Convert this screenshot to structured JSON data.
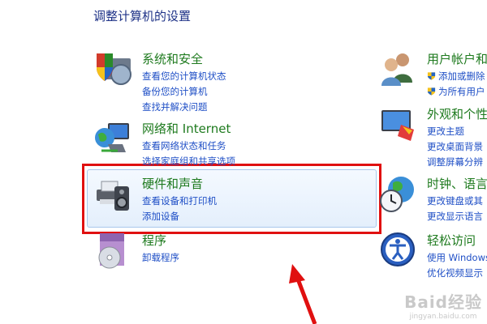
{
  "page_title": "调整计算机的设置",
  "left_column": [
    {
      "title": "系统和安全",
      "icon": "shield-computer-icon",
      "links": [
        "查看您的计算机状态",
        "备份您的计算机",
        "查找并解决问题"
      ]
    },
    {
      "title": "网络和 Internet",
      "icon": "globe-network-icon",
      "links": [
        "查看网络状态和任务",
        "选择家庭组和共享选项"
      ]
    },
    {
      "title": "硬件和声音",
      "icon": "printer-speaker-icon",
      "links": [
        "查看设备和打印机",
        "添加设备"
      ],
      "highlighted": true
    },
    {
      "title": "程序",
      "icon": "programs-disc-icon",
      "links": [
        "卸载程序"
      ]
    }
  ],
  "right_column": [
    {
      "title": "用户帐户和",
      "icon": "users-icon",
      "links": [
        "添加或删除",
        "为所有用户"
      ]
    },
    {
      "title": "外观和个性",
      "icon": "appearance-icon",
      "links": [
        "更改主题",
        "更改桌面背景",
        "调整屏幕分辨"
      ]
    },
    {
      "title": "时钟、语言",
      "icon": "clock-globe-icon",
      "links": [
        "更改键盘或其",
        "更改显示语言"
      ]
    },
    {
      "title": "轻松访问",
      "icon": "ease-of-access-icon",
      "links": [
        "使用 Windows",
        "优化视频显示"
      ]
    }
  ],
  "watermark": {
    "main": "Baid经验",
    "sub": "jingyan.baidu.com"
  },
  "colors": {
    "category_title": "#1e7a1e",
    "link": "#1f4fc6",
    "highlight_border": "#e01010",
    "arrow": "#e01010"
  }
}
